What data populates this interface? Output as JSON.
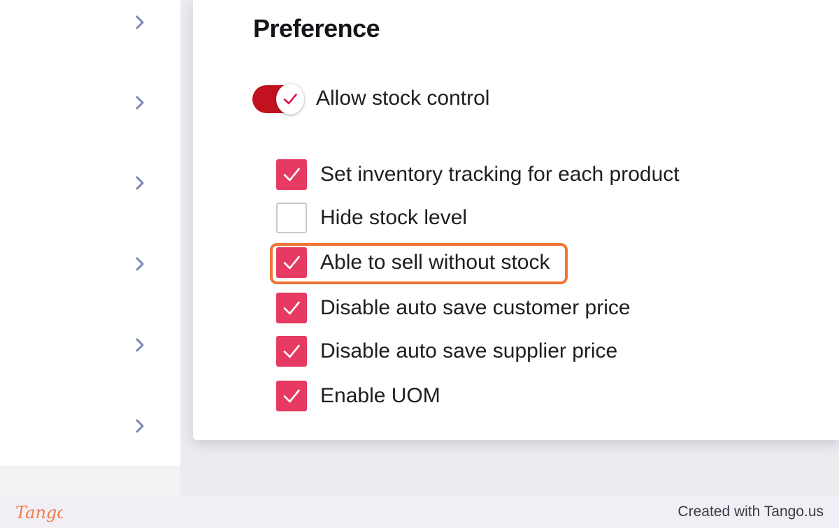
{
  "sidebar": {
    "chevrons": [
      "chevron-right-icon",
      "chevron-right-icon",
      "chevron-right-icon",
      "chevron-right-icon",
      "chevron-right-icon",
      "chevron-right-icon"
    ]
  },
  "section": {
    "title": "Preference"
  },
  "toggle": {
    "label": "Allow stock control",
    "checked": true,
    "color": "#c2121f"
  },
  "options": [
    {
      "label": "Set inventory tracking for each product",
      "checked": true
    },
    {
      "label": "Hide stock level",
      "checked": false
    },
    {
      "label": "Able to sell without stock",
      "checked": true,
      "highlighted": true
    },
    {
      "label": "Disable auto save customer price",
      "checked": true
    },
    {
      "label": "Disable auto save supplier price",
      "checked": true
    },
    {
      "label": "Enable UOM",
      "checked": true
    }
  ],
  "colors": {
    "checkbox_checked": "#e63a62",
    "highlight": "#ef7637",
    "chevron": "#7b86b3"
  },
  "footer": {
    "logo_text": "Tango",
    "credit": "Created with Tango.us"
  }
}
